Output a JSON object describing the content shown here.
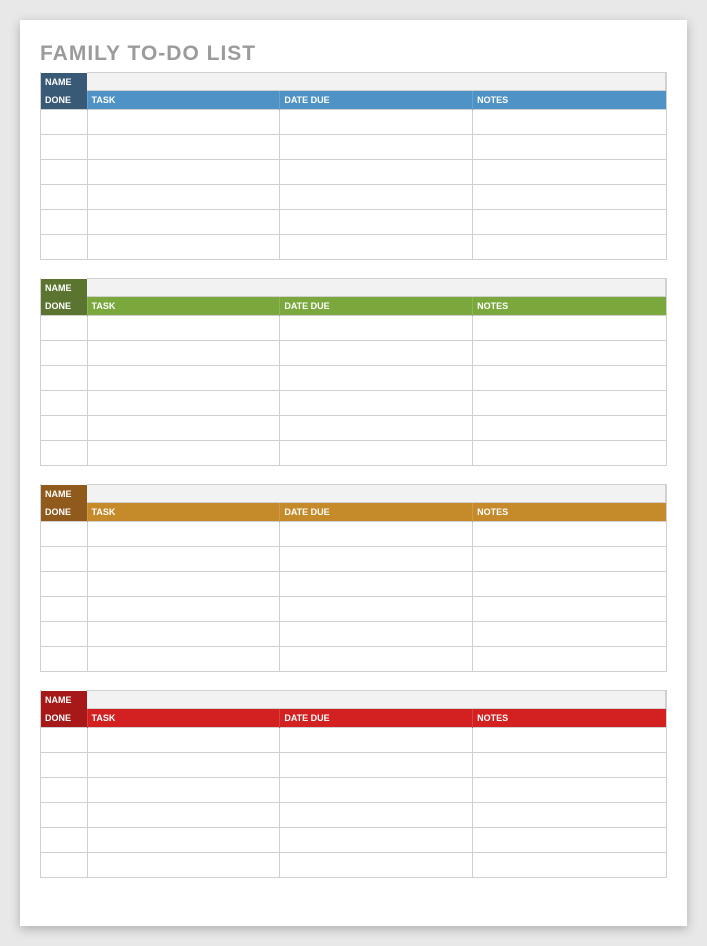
{
  "title": "FAMILY TO-DO LIST",
  "labels": {
    "name": "NAME",
    "done": "DONE",
    "task": "TASK",
    "date_due": "DATE DUE",
    "notes": "NOTES"
  },
  "sections": [
    {
      "colors": {
        "name_bg": "theme-blue-dark",
        "done_bg": "theme-blue-dark",
        "rest_bg": "theme-blue-light"
      },
      "name_value": "",
      "rows": [
        {
          "done": "",
          "task": "",
          "date_due": "",
          "notes": ""
        },
        {
          "done": "",
          "task": "",
          "date_due": "",
          "notes": ""
        },
        {
          "done": "",
          "task": "",
          "date_due": "",
          "notes": ""
        },
        {
          "done": "",
          "task": "",
          "date_due": "",
          "notes": ""
        },
        {
          "done": "",
          "task": "",
          "date_due": "",
          "notes": ""
        },
        {
          "done": "",
          "task": "",
          "date_due": "",
          "notes": ""
        }
      ]
    },
    {
      "colors": {
        "name_bg": "theme-green-dark",
        "done_bg": "theme-green-dark",
        "rest_bg": "theme-green-light"
      },
      "name_value": "",
      "rows": [
        {
          "done": "",
          "task": "",
          "date_due": "",
          "notes": ""
        },
        {
          "done": "",
          "task": "",
          "date_due": "",
          "notes": ""
        },
        {
          "done": "",
          "task": "",
          "date_due": "",
          "notes": ""
        },
        {
          "done": "",
          "task": "",
          "date_due": "",
          "notes": ""
        },
        {
          "done": "",
          "task": "",
          "date_due": "",
          "notes": ""
        },
        {
          "done": "",
          "task": "",
          "date_due": "",
          "notes": ""
        }
      ]
    },
    {
      "colors": {
        "name_bg": "theme-brown-dark",
        "done_bg": "theme-brown-dark",
        "rest_bg": "theme-brown-light"
      },
      "name_value": "",
      "rows": [
        {
          "done": "",
          "task": "",
          "date_due": "",
          "notes": ""
        },
        {
          "done": "",
          "task": "",
          "date_due": "",
          "notes": ""
        },
        {
          "done": "",
          "task": "",
          "date_due": "",
          "notes": ""
        },
        {
          "done": "",
          "task": "",
          "date_due": "",
          "notes": ""
        },
        {
          "done": "",
          "task": "",
          "date_due": "",
          "notes": ""
        },
        {
          "done": "",
          "task": "",
          "date_due": "",
          "notes": ""
        }
      ]
    },
    {
      "colors": {
        "name_bg": "theme-red-dark",
        "done_bg": "theme-red-dark",
        "rest_bg": "theme-red-light"
      },
      "name_value": "",
      "rows": [
        {
          "done": "",
          "task": "",
          "date_due": "",
          "notes": ""
        },
        {
          "done": "",
          "task": "",
          "date_due": "",
          "notes": ""
        },
        {
          "done": "",
          "task": "",
          "date_due": "",
          "notes": ""
        },
        {
          "done": "",
          "task": "",
          "date_due": "",
          "notes": ""
        },
        {
          "done": "",
          "task": "",
          "date_due": "",
          "notes": ""
        },
        {
          "done": "",
          "task": "",
          "date_due": "",
          "notes": ""
        }
      ]
    }
  ]
}
